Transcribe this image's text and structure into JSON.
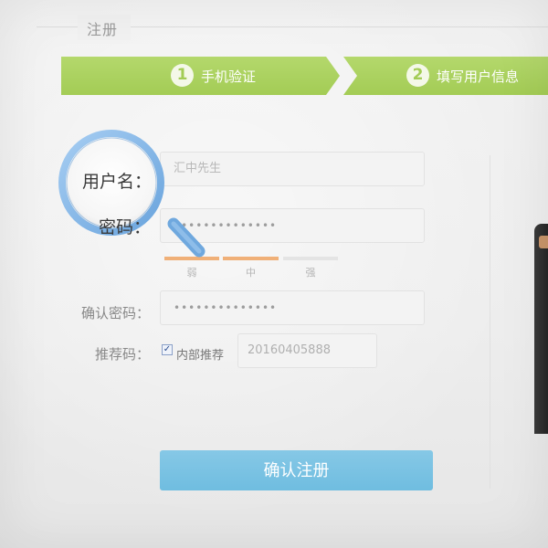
{
  "header": {
    "title": "注册"
  },
  "steps": [
    {
      "number": "1",
      "label": "手机验证"
    },
    {
      "number": "2",
      "label": "填写用户信息"
    }
  ],
  "form": {
    "username": {
      "label": "用户名：",
      "placeholder": "汇中先生"
    },
    "password": {
      "label": "密码：",
      "value": "••••••••••••••"
    },
    "strength": {
      "weak": "弱",
      "medium": "中",
      "strong": "强"
    },
    "confirm": {
      "label": "确认密码：",
      "value": "••••••••••••••"
    },
    "referral": {
      "label": "推荐码：",
      "checkbox_label": "内部推荐",
      "checkbox_checked": true,
      "value": "20160405888"
    },
    "submit_label": "确认注册"
  },
  "colors": {
    "step_green": "#a3cc55",
    "button_blue": "#75c0e2",
    "strength_orange": "#f0b078",
    "magnifier_blue": "#7fb3e6"
  },
  "icons": {
    "magnifier": "magnifier-icon",
    "check": "check-icon"
  }
}
